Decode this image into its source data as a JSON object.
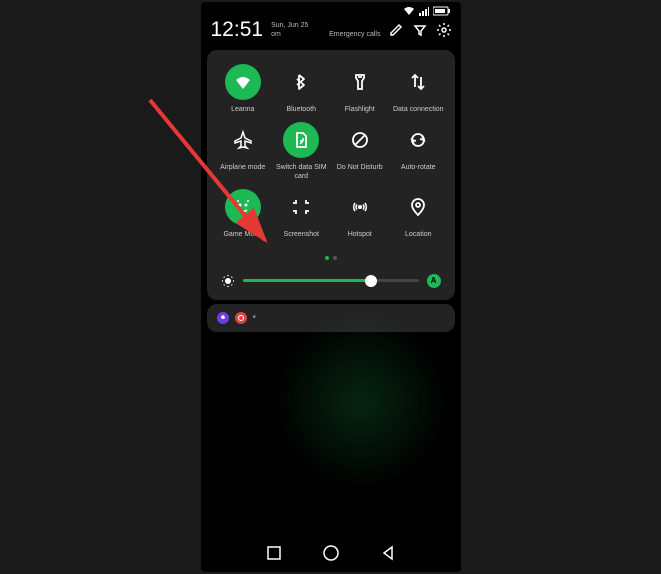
{
  "status": {
    "time": "12:51",
    "date": "Sun, Jun 25",
    "carrier": "om",
    "emergency": "Emergency calls"
  },
  "tiles": [
    {
      "label": "Leanna",
      "icon": "wifi",
      "active": true
    },
    {
      "label": "Bluetooth",
      "icon": "bluetooth",
      "active": false
    },
    {
      "label": "Flashlight",
      "icon": "flashlight",
      "active": false
    },
    {
      "label": "Data connection",
      "icon": "data",
      "active": false
    },
    {
      "label": "Airplane mode",
      "icon": "airplane",
      "active": false
    },
    {
      "label": "Switch data SIM card",
      "icon": "sim",
      "active": true
    },
    {
      "label": "Do Not Disturb",
      "icon": "dnd",
      "active": false
    },
    {
      "label": "Auto-rotate",
      "icon": "rotate",
      "active": false
    },
    {
      "label": "Game Mode",
      "icon": "game",
      "active": true
    },
    {
      "label": "Screenshot",
      "icon": "screenshot",
      "active": false
    },
    {
      "label": "Hotspot",
      "icon": "hotspot",
      "active": false
    },
    {
      "label": "Location",
      "icon": "location",
      "active": false
    }
  ],
  "brightness": {
    "auto_label": "A",
    "value": 73
  },
  "notification": {
    "dot": "•"
  }
}
